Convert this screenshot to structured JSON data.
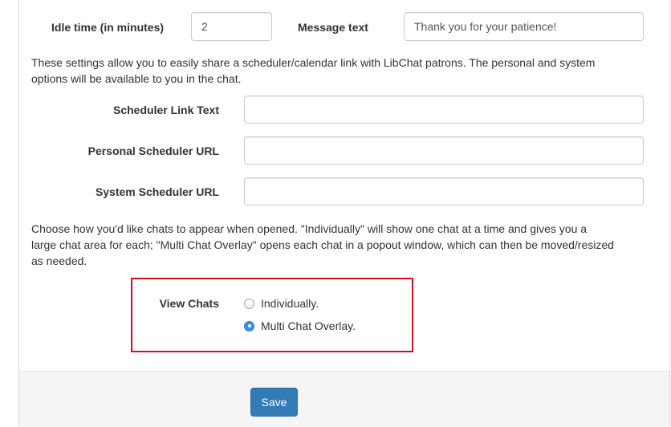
{
  "idle": {
    "label": "Idle time (in minutes)",
    "value": "2"
  },
  "message": {
    "label": "Message text",
    "value": "Thank you for your patience!"
  },
  "scheduler_intro_line1": "These settings allow you to easily share a scheduler/calendar link with LibChat patrons. The personal and system",
  "scheduler_intro_line2": "options will be available to you in the chat.",
  "scheduler_link_text": {
    "label": "Scheduler Link Text",
    "value": ""
  },
  "personal_scheduler_url": {
    "label": "Personal Scheduler URL",
    "value": ""
  },
  "system_scheduler_url": {
    "label": "System Scheduler URL",
    "value": ""
  },
  "view_intro_line1": "Choose how you'd like chats to appear when opened. \"Individually\" will show one chat at a time and gives you a",
  "view_intro_line2": "large chat area for each; \"Multi Chat Overlay\" opens each chat in a popout window, which can then be moved/resized",
  "view_intro_line3": "as needed.",
  "view_chats": {
    "label": "View Chats",
    "options": [
      {
        "label": "Individually.",
        "checked": false
      },
      {
        "label": "Multi Chat Overlay.",
        "checked": true
      }
    ]
  },
  "save_label": "Save",
  "colors": {
    "highlight": "#d0111b",
    "primary": "#337ab7",
    "radio_selected": "#3b8eea"
  }
}
